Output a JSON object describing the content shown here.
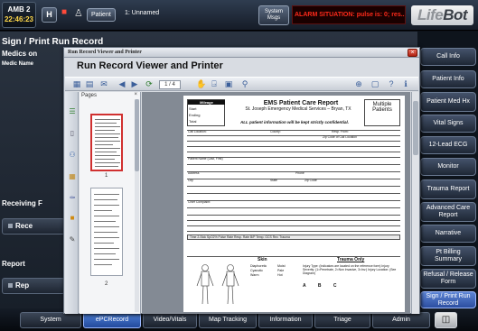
{
  "topbar": {
    "unit_name": "AMB 2",
    "unit_time": "22:46:23",
    "hospital_label": "H",
    "patient_button": "Patient",
    "patient_name": "1: Unnamed",
    "system_msgs": [
      "System",
      "Msgs"
    ],
    "alarm_text": "ALARM SITUATION: pulse is: 0; res...",
    "logo_part1": "Life",
    "logo_part2": "Bot"
  },
  "background": {
    "page_title": "Sign / Print Run Record",
    "medics_label": "Medics on",
    "medic_name_label": "Medic Name",
    "receiving_label": "Receiving F",
    "receiving_button": "Rece",
    "report_label": "Report",
    "report_button": "Rep"
  },
  "right_nav": {
    "items": [
      {
        "label": "Call Info",
        "active": false
      },
      {
        "label": "Patient Info",
        "active": false
      },
      {
        "label": "Patient Med Hx",
        "active": false
      },
      {
        "label": "Vital Signs",
        "active": false
      },
      {
        "label": "12-Lead ECG",
        "active": false
      },
      {
        "label": "Monitor",
        "active": false
      },
      {
        "label": "Trauma Report",
        "active": false
      },
      {
        "label": "Advanced Care Report",
        "active": false
      },
      {
        "label": "Narrative",
        "active": false
      },
      {
        "label": "Pt Billing Summary",
        "active": false
      },
      {
        "label": "Refusal / Release Form",
        "active": false
      },
      {
        "label": "Sign / Print Run Record",
        "active": true
      }
    ]
  },
  "bottom_tabs": [
    {
      "label": "System",
      "active": false
    },
    {
      "label": "ePCRecord",
      "active": true
    },
    {
      "label": "Video/Vitals",
      "active": false
    },
    {
      "label": "Map Tracking",
      "active": false
    },
    {
      "label": "Information",
      "active": false
    },
    {
      "label": "Triage",
      "active": false
    },
    {
      "label": "Admin",
      "active": false
    }
  ],
  "viewer": {
    "window_title": "Run Record Viewer and Printer",
    "heading": "Run Record Viewer and Printer",
    "page_indicator": "1 / 4",
    "pages_label": "Pages",
    "thumb_numbers": [
      "1",
      "2"
    ]
  },
  "form": {
    "mileage": "Mileage",
    "start": "Start",
    "ending": "Ending",
    "total": "Total",
    "title": "EMS Patient Care Report",
    "subtitle": "St. Joseph Emergency Medical Services – Bryan, TX",
    "multiple": "Multiple",
    "patients": "Patients",
    "confidential": "ALL patient information will be kept strictly confidential.",
    "call_location": "Call Location:",
    "county": "County:",
    "resp_from": "Resp. From:",
    "zip_label": "Zip Code of Call Location",
    "patient_name": "Patient Name (Last, First)",
    "address": "Address",
    "city": "City",
    "state": "State",
    "zip": "Zip Code",
    "phone": "Phone",
    "chief_complaint": "Chief Complaint:",
    "vitals_header": "Time    2-Stck    SpO2%    Pulse Rate    Resp. Rate    B/P    Temp.    GCS    Rev. Trauma",
    "skin": "Skin",
    "trauma_only": "Trauma Only",
    "skin_opts1": [
      "Diaphoretic",
      "Cyanotic",
      "Warm"
    ],
    "skin_opts2": [
      "Moist",
      "Pale",
      "Hot"
    ],
    "trauma_text": "Injury Type: (Indicators are located on the reference form) Injury Severity: (1=Penetrate, 2=Non Invasive, 3=Inv.) Injury Location: (See Diagram)",
    "abc": "A  B  C"
  }
}
